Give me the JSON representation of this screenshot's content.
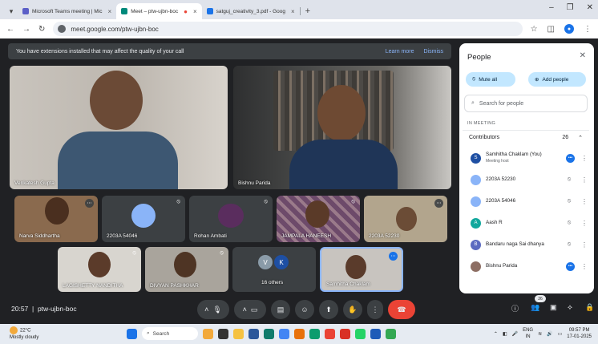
{
  "browser": {
    "tabs": [
      {
        "label": "Microsoft Teams meeting | Mic",
        "favicon_color": "#5b5fc7"
      },
      {
        "label": "Meet – ptw-ujbn-boc",
        "favicon_color": "#00897b"
      },
      {
        "label": "satguj_creativity_3.pdf - Goog",
        "favicon_color": "#1a73e8"
      }
    ],
    "new_tab": "+",
    "url": "meet.google.com/ptw-ujbn-boc"
  },
  "banner": {
    "message": "You have extensions installed that may affect the quality of your call",
    "learn_more": "Learn more",
    "dismiss": "Dismiss"
  },
  "tiles": {
    "main_left": {
      "name": "Venkatesh Gupta"
    },
    "main_right": {
      "name": "Bishnu Parida"
    },
    "row1": [
      {
        "name": "Narva Siddhartha"
      },
      {
        "name": "2203A 54046"
      },
      {
        "name": "Rohan Ambati"
      },
      {
        "name": "JAMPALA HANEESH"
      },
      {
        "name": "2203A 52230"
      }
    ],
    "row2": [
      {
        "name": "LAGISHETTY NANDITHA"
      },
      {
        "name": "DIVYAN PASHKHAR"
      },
      {
        "name": "16 others",
        "initials": [
          "V",
          "K"
        ]
      },
      {
        "name": "Samhitha Chaklam"
      }
    ]
  },
  "panel": {
    "title": "People",
    "mute_all": "Mute all",
    "add_people": "Add people",
    "search_placeholder": "Search for people",
    "section": "IN MEETING",
    "contributors_label": "Contributors",
    "contributors_count": "26",
    "people": [
      {
        "name": "Samhitha Chaklam (You)",
        "sub": "Meeting host",
        "initial": "S",
        "color": "#1e4fa3"
      },
      {
        "name": "2203A 52230",
        "sub": "",
        "initial": "",
        "color": "#8ab4f8"
      },
      {
        "name": "2203A 54046",
        "sub": "",
        "initial": "",
        "color": "#8ab4f8"
      },
      {
        "name": "Aash R",
        "sub": "",
        "initial": "A",
        "color": "#12a89d"
      },
      {
        "name": "Bandaru naga Sai dhanya",
        "sub": "",
        "initial": "B",
        "color": "#5c6bc0"
      },
      {
        "name": "Bishnu Parida",
        "sub": "",
        "initial": "",
        "color": "#8d6e63"
      }
    ]
  },
  "bottom": {
    "time": "20:57",
    "meeting_code": "ptw-ujbn-boc",
    "participants_badge": "26"
  },
  "taskbar": {
    "temperature": "22°C",
    "weather": "Mostly cloudy",
    "search": "Search",
    "lang": "ENG",
    "region": "IN",
    "time": "09:57 PM",
    "date": "17-01-2025"
  }
}
